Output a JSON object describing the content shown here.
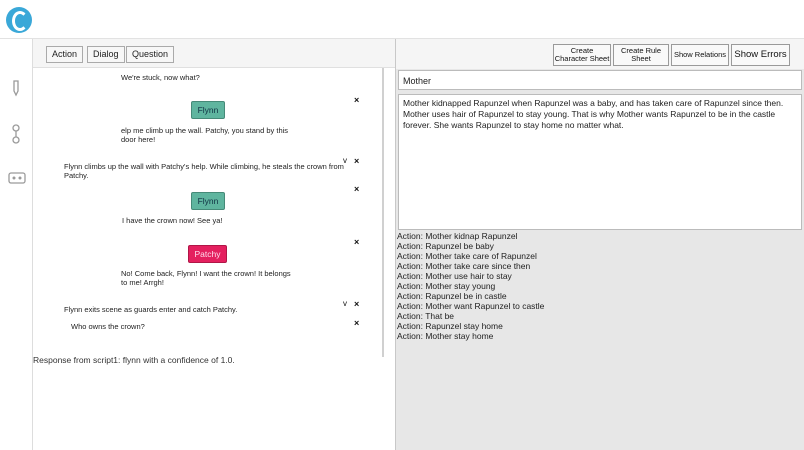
{
  "left_toolbar": {
    "action": "Action",
    "dialog": "Dialog",
    "question": "Question"
  },
  "script_lines": {
    "l1": "We're stuck, now what?",
    "l2": "elp me climb up the wall. Patchy, you stand by this",
    "l2b": "door here!",
    "l3": "Flynn climbs up the wall with Patchy's help. While climbing, he steals the crown from",
    "l3b": "Patchy.",
    "l4": "I have the crown now! See ya!",
    "l5": "No! Come back, Flynn! I want the crown! It belongs",
    "l5b": "to me! Arrgh!",
    "l6": "Flynn exits scene as guards enter and catch Patchy.",
    "l7": "Who owns the crown?"
  },
  "chips": {
    "flynn1": "Flynn",
    "flynn2": "Flynn",
    "patchy": "Patchy"
  },
  "glyphs": {
    "close": "×",
    "chevron": "v"
  },
  "response": "Response from script1: flynn with a confidence of 1.0.",
  "right_toolbar": {
    "create_char_1": "Create",
    "create_char_2": "Character Sheet",
    "create_rule_1": "Create Rule",
    "create_rule_2": "Sheet",
    "show_relations": "Show Relations",
    "show_errors": "Show Errors"
  },
  "character_name": "Mother",
  "story_text": "Mother kidnapped Rapunzel when Rapunzel was a baby, and has taken care of Rapunzel since then. Mother uses hair of Rapunzel to stay young. That is why Mother wants Rapunzel to be in the castle forever. She wants Rapunzel to stay home no matter what.",
  "actions": [
    "Action: Mother kidnap Rapunzel",
    "Action: Rapunzel be baby",
    "Action: Mother take care of Rapunzel",
    "Action: Mother take care since then",
    "Action: Mother use hair to stay",
    "Action: Mother stay young",
    "Action: Rapunzel be in castle",
    "Action: Mother want Rapunzel to castle",
    "Action: That be",
    "Action: Rapunzel stay home",
    "Action: Mother stay home"
  ],
  "colors": {
    "logo": "#3aa8d8",
    "flynn_chip": "#5fb59f",
    "patchy_chip": "#e4205f"
  },
  "icons": [
    "logo-icon",
    "pen-icon",
    "link-icon",
    "vr-icon",
    "close-icon",
    "chevron-down-icon"
  ]
}
